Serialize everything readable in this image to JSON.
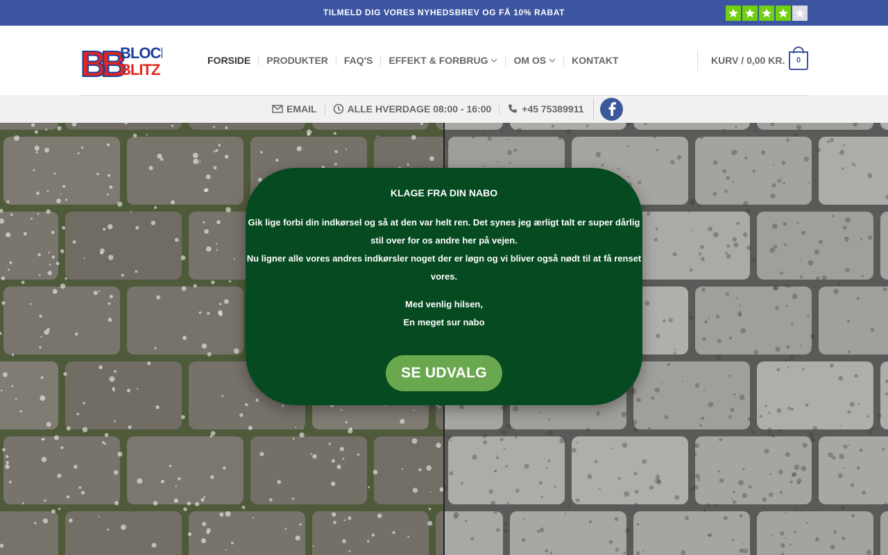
{
  "topbar": {
    "newsletter_text": "TILMELD DIG VORES NYHEDSBREV OG FÅ 10% RABAT",
    "rating_stars": 4,
    "rating_max": 5,
    "star_color": "#73cf11"
  },
  "header": {
    "logo_text_line1": "BLOCK",
    "logo_text_line2": "BLITZ",
    "logo_monogram": "BB",
    "nav": [
      {
        "label": "FORSIDE"
      },
      {
        "label": "PRODUKTER"
      },
      {
        "label": "FAQ'S"
      },
      {
        "label": "EFFEKT & FORBRUG"
      },
      {
        "label": "OM OS"
      },
      {
        "label": "KONTAKT"
      }
    ],
    "cart_label": "KURV / 0,00 KR.",
    "cart_count": "0"
  },
  "infobar": {
    "email_label": "EMAIL",
    "hours_label": "ALLE HVERDAGE 08:00 - 16:00",
    "phone_label": "+45 75389911",
    "social_icon": "facebook-icon"
  },
  "popup": {
    "title": "KLAGE FRA DIN NABO",
    "body_line1": "Gik lige forbi din indkørsel og så at den var helt ren. Det synes jeg ærligt talt er super dårlig",
    "body_line2": "stil over for os andre her på vejen.",
    "body_line3": "Nu ligner alle vores andres indkørsler noget der er løgn og vi bliver også nødt til at få renset",
    "body_line4": "vores.",
    "sign_line1": "Med venlig hilsen,",
    "sign_line2": "En meget sur nabo",
    "button_label": "SE UDVALG"
  },
  "colors": {
    "brand_blue": "#3b55a0",
    "popup_green": "#054a20",
    "button_green": "#6aa84f",
    "facebook_blue": "#3b5998"
  }
}
